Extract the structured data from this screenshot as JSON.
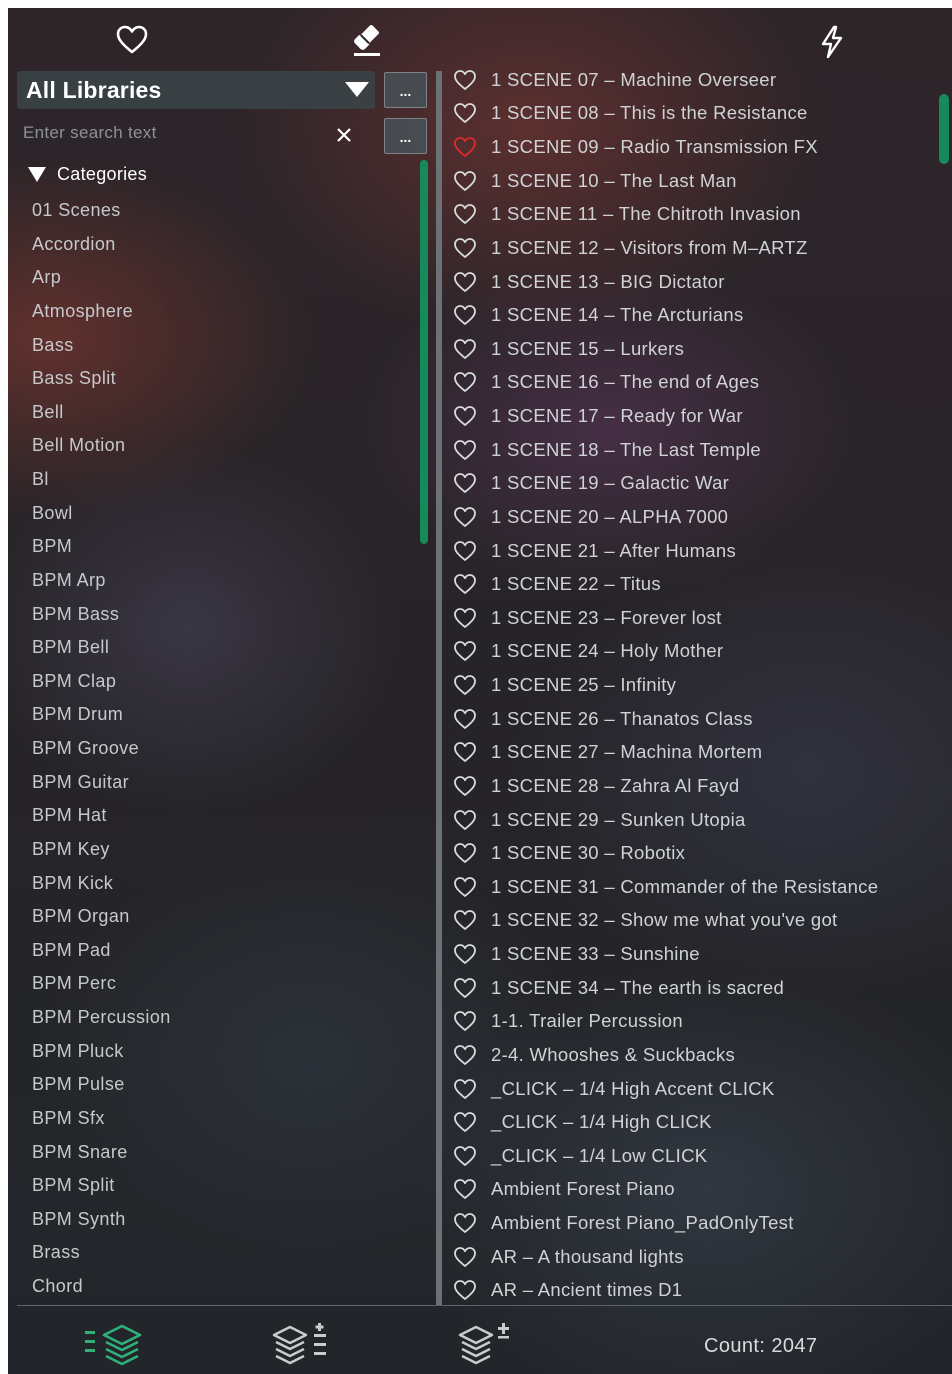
{
  "toolbar": {
    "favorites_icon": "heart-outline",
    "clear_icon": "eraser",
    "quick_icon": "lightning-bolt"
  },
  "library": {
    "selected": "All Libraries",
    "more_label": "..."
  },
  "search": {
    "placeholder": "Enter search text",
    "value": "",
    "more_label": "..."
  },
  "categories": {
    "header": "Categories",
    "items": [
      "01 Scenes",
      "Accordion",
      "Arp",
      "Atmosphere",
      "Bass",
      "Bass Split",
      "Bell",
      "Bell Motion",
      "Bl",
      "Bowl",
      "BPM",
      "BPM Arp",
      "BPM Bass",
      "BPM Bell",
      "BPM Clap",
      "BPM Drum",
      "BPM Groove",
      "BPM Guitar",
      "BPM Hat",
      "BPM Key",
      "BPM Kick",
      "BPM Organ",
      "BPM Pad",
      "BPM Perc",
      "BPM Percussion",
      "BPM Pluck",
      "BPM Pulse",
      "BPM Sfx",
      "BPM Snare",
      "BPM Split",
      "BPM Synth",
      "Brass",
      "Chord"
    ]
  },
  "presets": [
    {
      "name": "1 SCENE 07 – Machine Overseer",
      "favorite": false
    },
    {
      "name": "1 SCENE 08 – This is the Resistance",
      "favorite": false
    },
    {
      "name": "1 SCENE 09 – Radio Transmission FX",
      "favorite": true
    },
    {
      "name": "1 SCENE 10 – The Last Man",
      "favorite": false
    },
    {
      "name": "1 SCENE 11 – The Chitroth Invasion",
      "favorite": false
    },
    {
      "name": "1 SCENE 12 – Visitors from M–ARTZ",
      "favorite": false
    },
    {
      "name": "1 SCENE 13 – BIG Dictator",
      "favorite": false
    },
    {
      "name": "1 SCENE 14 – The Arcturians",
      "favorite": false
    },
    {
      "name": "1 SCENE 15 – Lurkers",
      "favorite": false
    },
    {
      "name": "1 SCENE 16 – The end of Ages",
      "favorite": false
    },
    {
      "name": "1 SCENE 17 – Ready for War",
      "favorite": false
    },
    {
      "name": "1 SCENE 18 – The Last Temple",
      "favorite": false
    },
    {
      "name": "1 SCENE 19 – Galactic War",
      "favorite": false
    },
    {
      "name": "1 SCENE 20 – ALPHA 7000",
      "favorite": false
    },
    {
      "name": "1 SCENE 21 – After Humans",
      "favorite": false
    },
    {
      "name": "1 SCENE 22 – Titus",
      "favorite": false
    },
    {
      "name": "1 SCENE 23 – Forever lost",
      "favorite": false
    },
    {
      "name": "1 SCENE 24 – Holy Mother",
      "favorite": false
    },
    {
      "name": "1 SCENE 25 – Infinity",
      "favorite": false
    },
    {
      "name": "1 SCENE 26 – Thanatos Class",
      "favorite": false
    },
    {
      "name": "1 SCENE 27 – Machina Mortem",
      "favorite": false
    },
    {
      "name": "1 SCENE 28 – Zahra Al Fayd",
      "favorite": false
    },
    {
      "name": "1 SCENE 29 – Sunken Utopia",
      "favorite": false
    },
    {
      "name": "1 SCENE 30 – Robotix",
      "favorite": false
    },
    {
      "name": "1 SCENE 31 – Commander of the Resistance",
      "favorite": false
    },
    {
      "name": "1 SCENE 32 – Show me what you've got",
      "favorite": false
    },
    {
      "name": "1 SCENE 33 – Sunshine",
      "favorite": false
    },
    {
      "name": "1 SCENE 34 – The earth is sacred",
      "favorite": false
    },
    {
      "name": "1-1. Trailer Percussion",
      "favorite": false
    },
    {
      "name": "2-4. Whooshes & Suckbacks",
      "favorite": false
    },
    {
      "name": "_CLICK – 1/4 High Accent CLICK",
      "favorite": false
    },
    {
      "name": "_CLICK – 1/4 High CLICK",
      "favorite": false
    },
    {
      "name": "_CLICK – 1/4 Low CLICK",
      "favorite": false
    },
    {
      "name": "Ambient Forest Piano",
      "favorite": false
    },
    {
      "name": "Ambient Forest Piano_PadOnlyTest",
      "favorite": false
    },
    {
      "name": "AR – A thousand lights",
      "favorite": false
    },
    {
      "name": "AR – Ancient times D1",
      "favorite": false
    }
  ],
  "footer": {
    "count_label": "Count:",
    "count_value": "2047",
    "icons": [
      "layers-list",
      "layers-sort",
      "layers-add"
    ]
  },
  "colors": {
    "accent": "#168a5a",
    "favorite": "#e02a2a",
    "heart_outline": "#d8dbde",
    "icon_green": "#2fb079",
    "icon_gray": "#c9ccce"
  }
}
